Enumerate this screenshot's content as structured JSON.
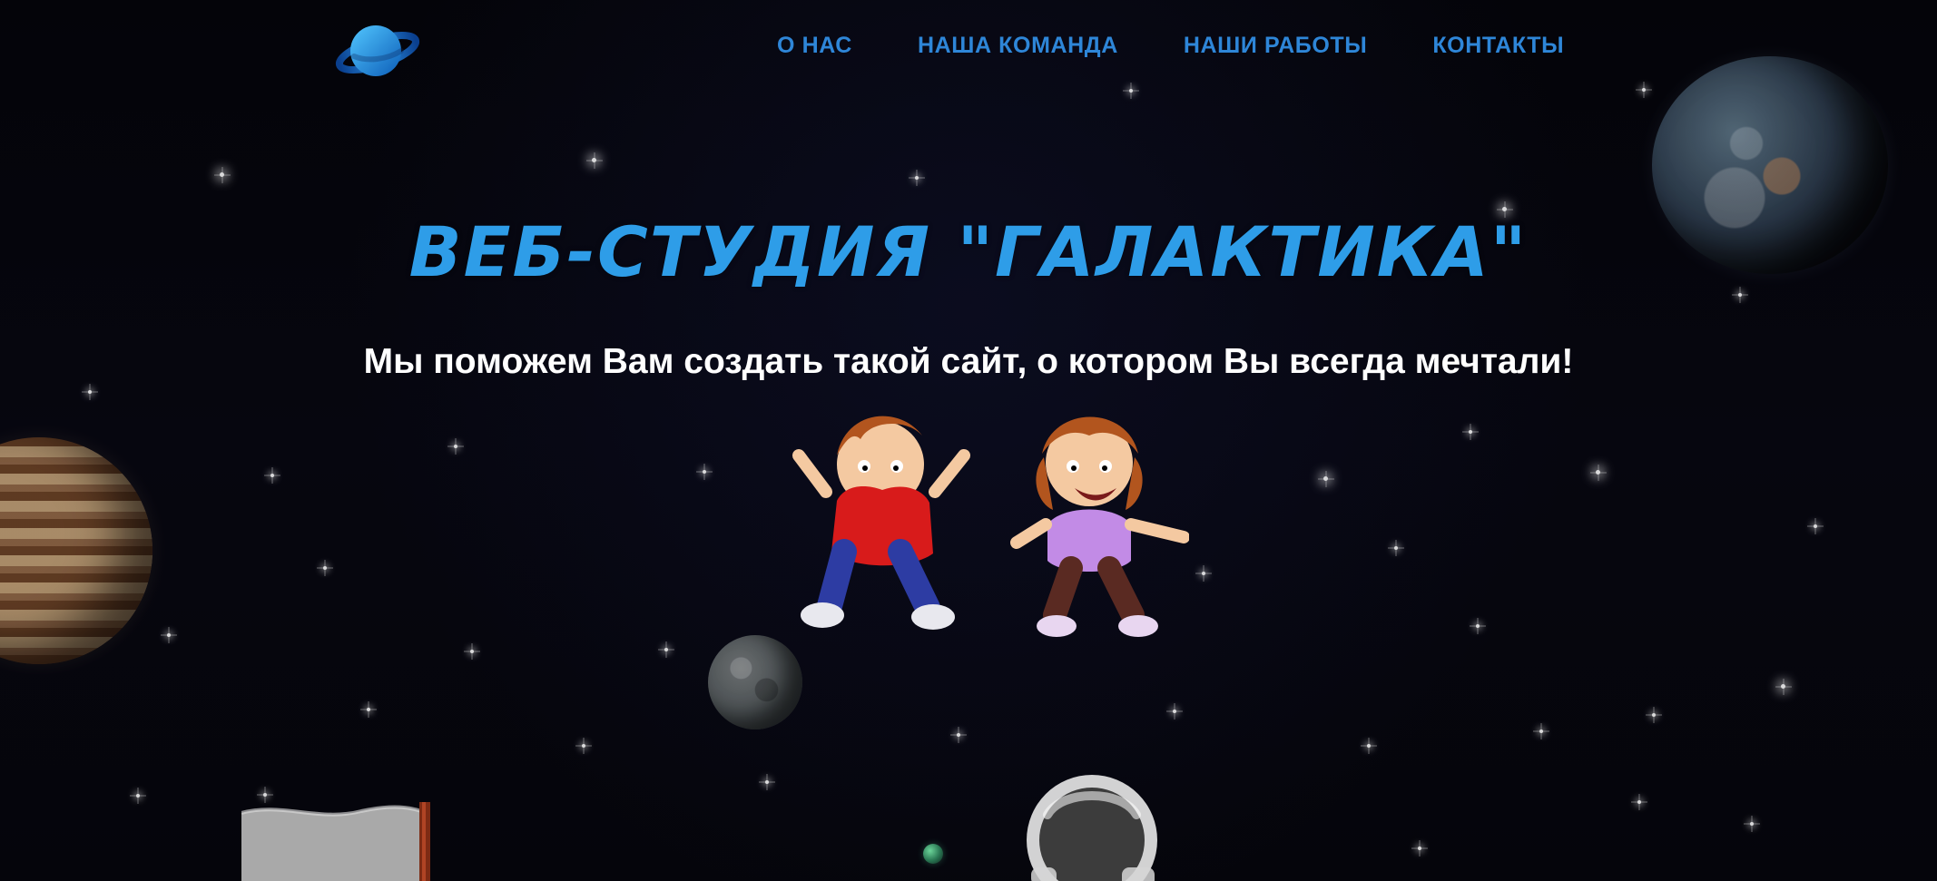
{
  "nav": {
    "items": [
      {
        "label": "О НАС"
      },
      {
        "label": "НАША КОМАНДА"
      },
      {
        "label": "НАШИ РАБОТЫ"
      },
      {
        "label": "КОНТАКТЫ"
      }
    ],
    "color": "#2e86d8"
  },
  "hero": {
    "title": "ВЕБ-СТУДИЯ \"ГАЛАКТИКА\"",
    "subtitle": "Мы поможем Вам создать такой сайт, о котором Вы всегда мечтали!",
    "title_color": "#2e9de8",
    "subtitle_color": "#ffffff"
  },
  "icons": {
    "logo": "planet-logo-icon"
  }
}
